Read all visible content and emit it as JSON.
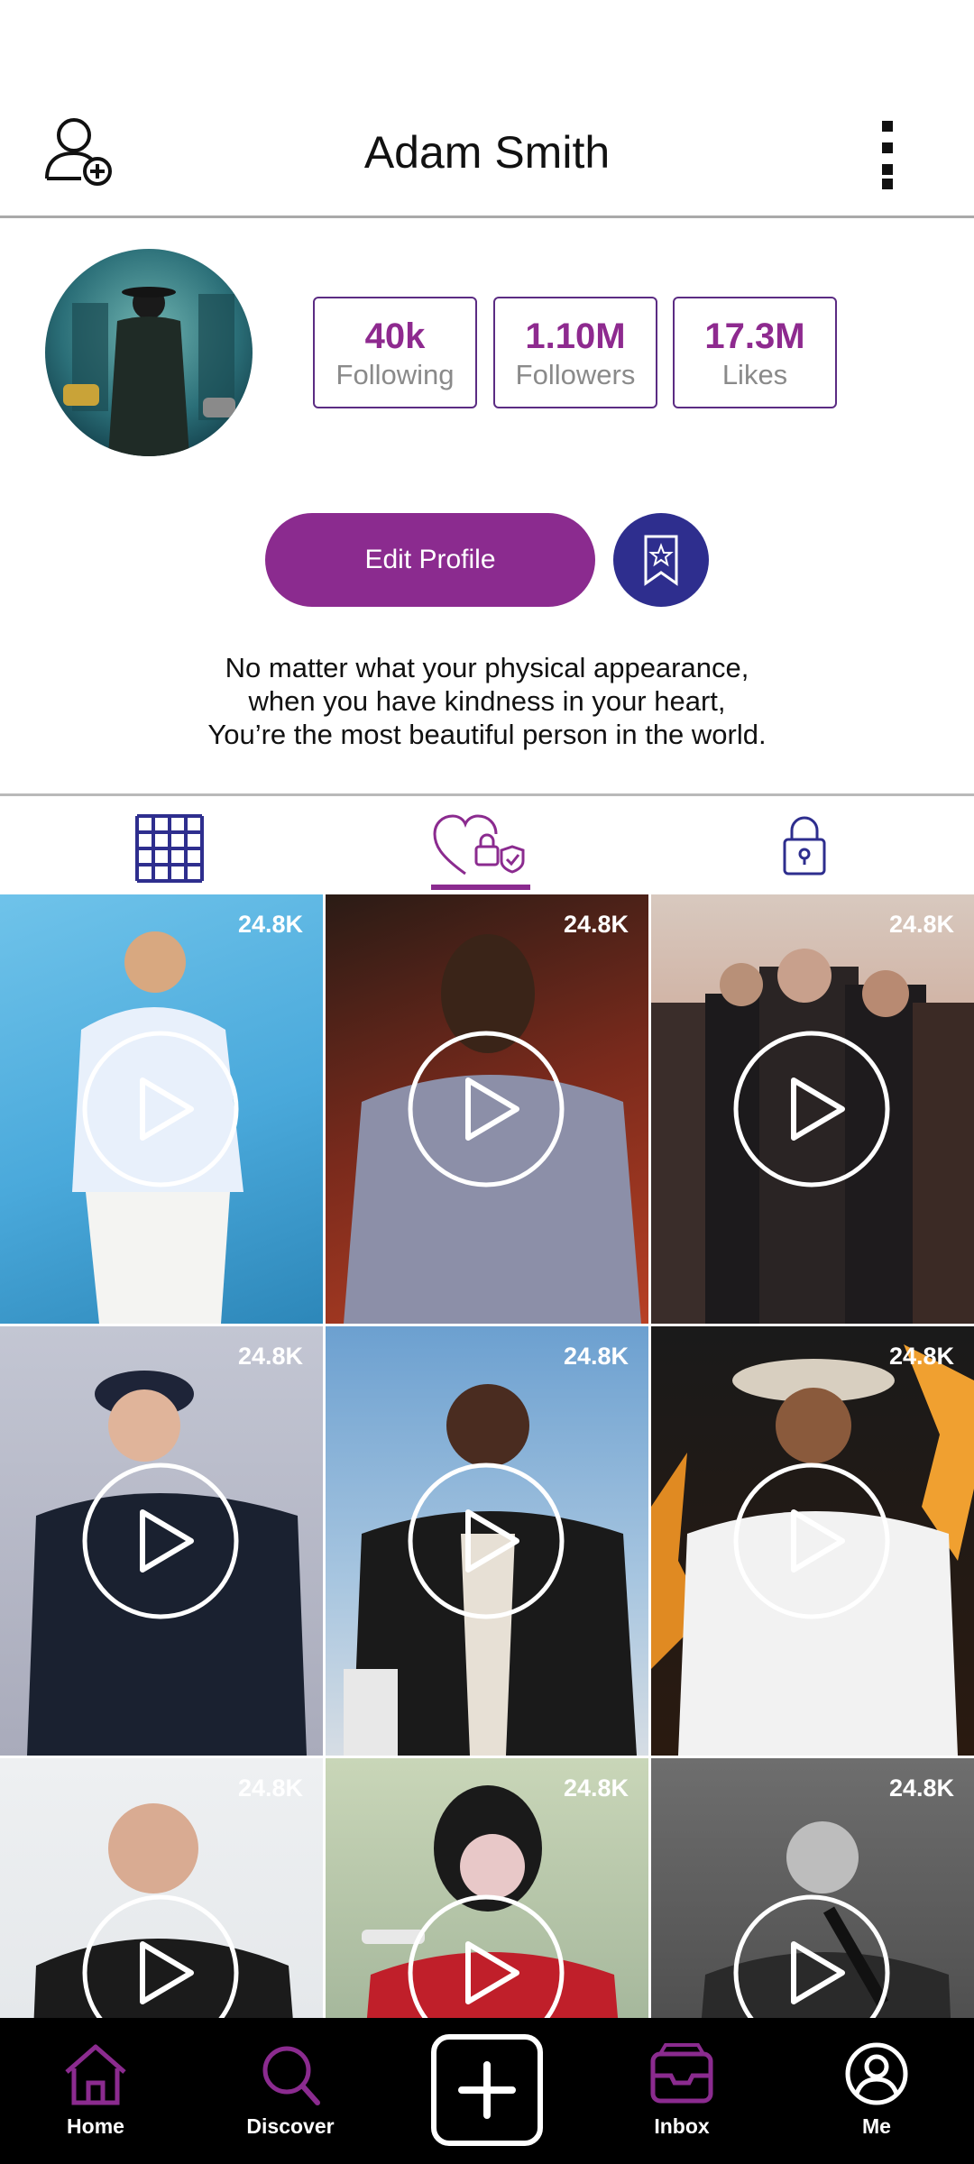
{
  "header": {
    "title": "Adam Smith"
  },
  "stats": [
    {
      "value": "40k",
      "label": "Following"
    },
    {
      "value": "1.10M",
      "label": "Followers"
    },
    {
      "value": "17.3M",
      "label": "Likes"
    }
  ],
  "actions": {
    "edit_profile_label": "Edit Profile"
  },
  "bio": {
    "line1": "No matter what your physical appearance,",
    "line2": "when you have kindness in your heart,",
    "line3": "You’re the most beautiful person in the world."
  },
  "tabs": [
    {
      "icon": "grid-icon"
    },
    {
      "icon": "liked-private-icon",
      "active": true
    },
    {
      "icon": "lock-icon"
    }
  ],
  "videos": [
    {
      "views": "24.8K"
    },
    {
      "views": "24.8K"
    },
    {
      "views": "24.8K"
    },
    {
      "views": "24.8K"
    },
    {
      "views": "24.8K"
    },
    {
      "views": "24.8K"
    },
    {
      "views": "24.8K"
    },
    {
      "views": "24.8K"
    },
    {
      "views": "24.8K"
    }
  ],
  "nav": {
    "home": "Home",
    "discover": "Discover",
    "inbox": "Inbox",
    "me": "Me"
  },
  "colors": {
    "accent": "#8b2b8f",
    "secondary": "#2e2e8e",
    "nav_bg": "#000000"
  }
}
